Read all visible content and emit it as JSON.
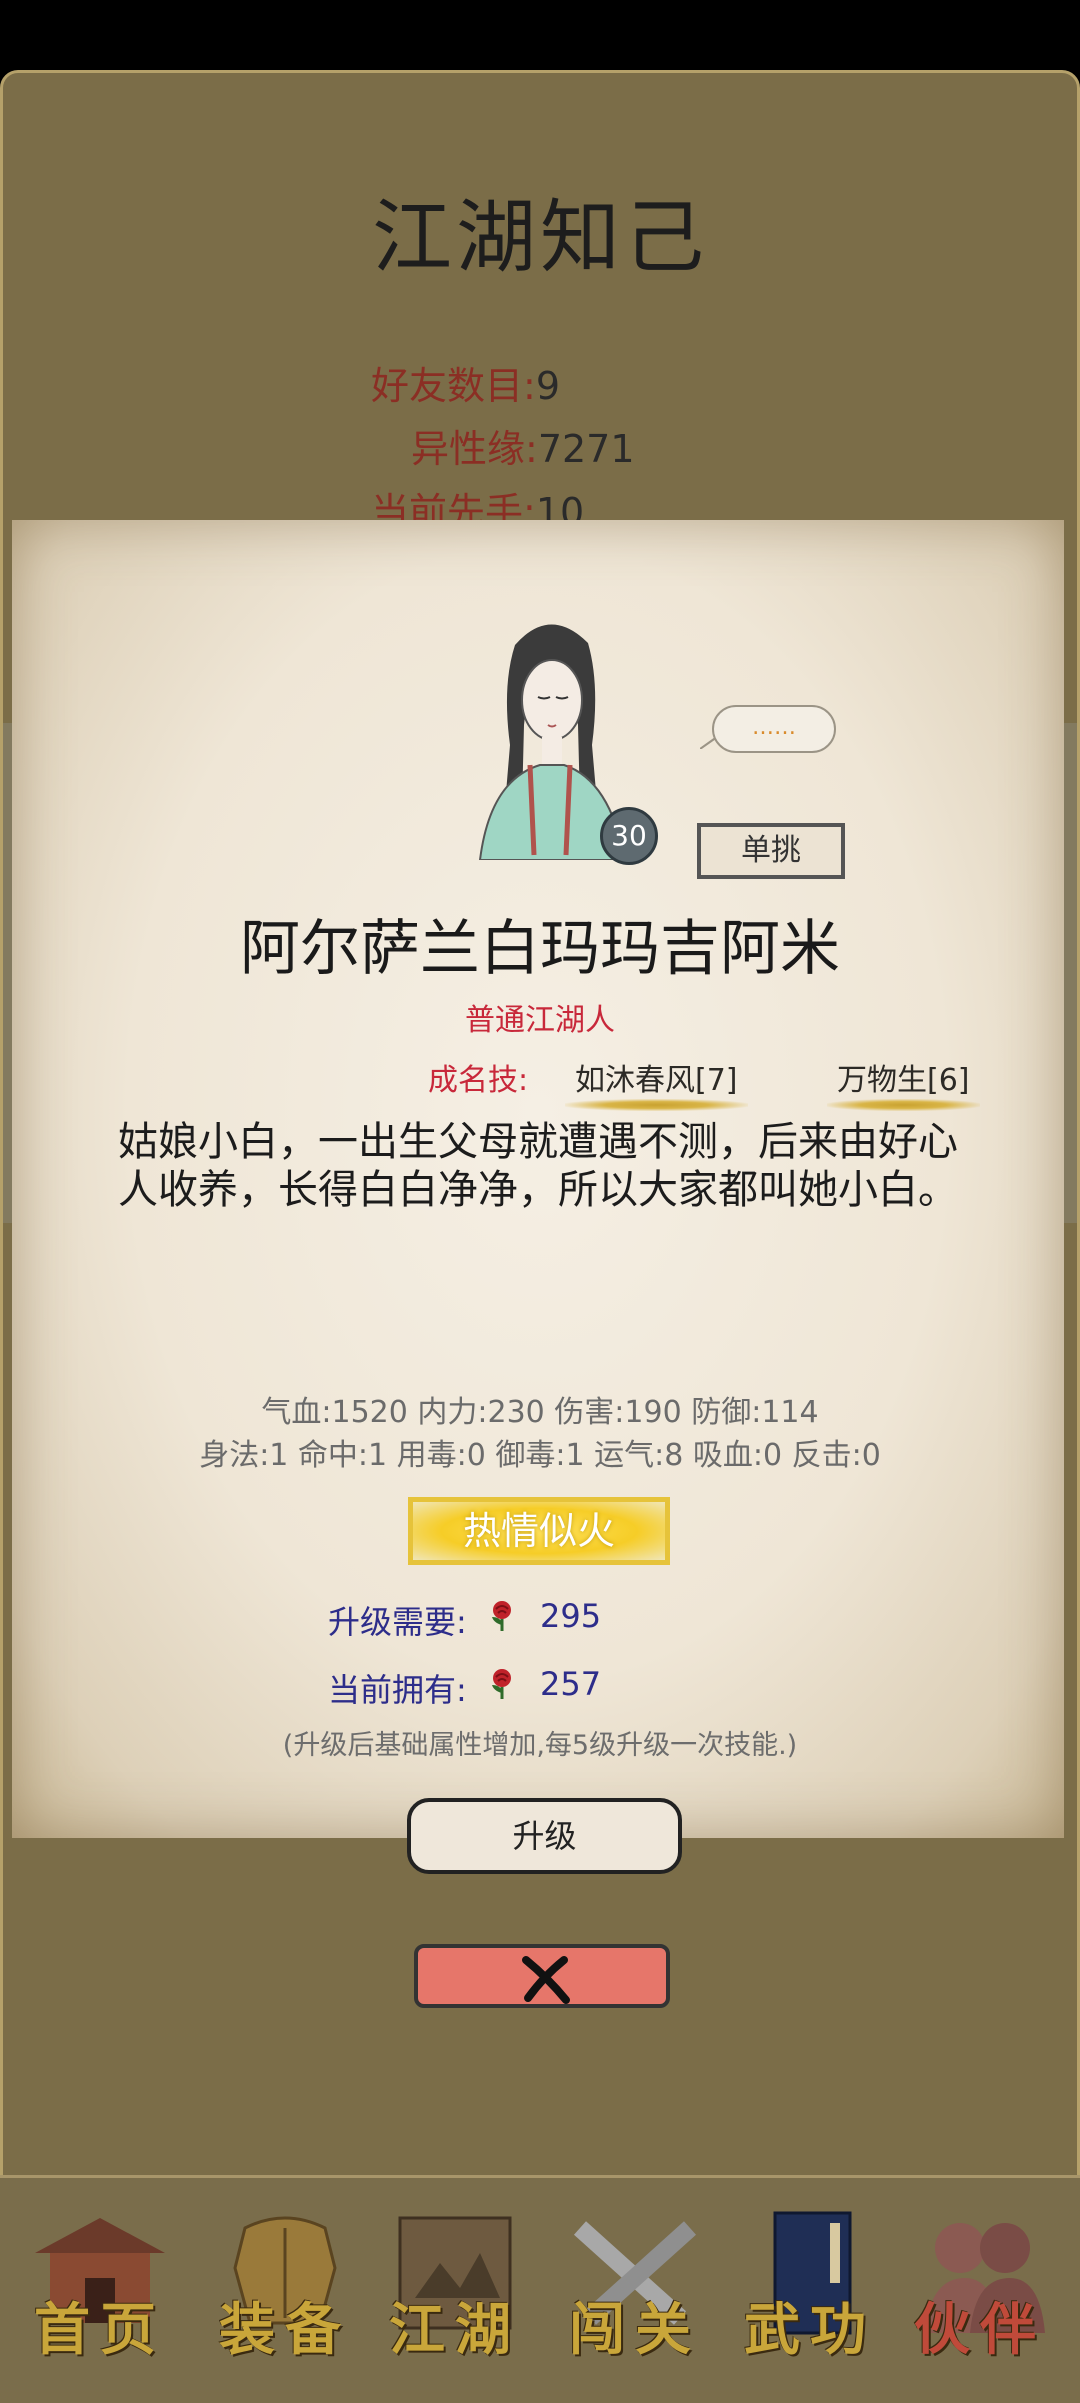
{
  "title": "江湖知己",
  "stats": {
    "friends_label": "好友数目:",
    "friends_value": "9",
    "affinity_label": "异性缘:",
    "affinity_value": "7271",
    "initiative_label": "当前先手:",
    "initiative_value": "10"
  },
  "hero": {
    "level": "30",
    "speech": "……",
    "duel_label": "单挑",
    "name": "阿尔萨兰白玛玛吉阿米",
    "rank": "普通江湖人",
    "skills_label": "成名技:",
    "skills": [
      "如沐春风[7]",
      "万物生[6]"
    ],
    "bio": "姑娘小白，一出生父母就遭遇不测，后来由好心人收养，长得白白净净，所以大家都叫她小白。",
    "attributes_line1": "气血:1520  内力:230  伤害:190  防御:114",
    "attributes_line2": "身法:1  命中:1  用毒:0  御毒:1  运气:8  吸血:0  反击:0",
    "mood_label": "热情似火",
    "upgrade_need_label": "升级需要:",
    "upgrade_need_value": "295",
    "current_have_label": "当前拥有:",
    "current_have_value": "257",
    "note": "(升级后基础属性增加,每5级升级一次技能.)",
    "upgrade_button": "升级"
  },
  "nav": [
    {
      "label": "首页",
      "icon": "house-icon"
    },
    {
      "label": "装备",
      "icon": "armor-icon"
    },
    {
      "label": "江湖",
      "icon": "map-scroll-icon"
    },
    {
      "label": "闯关",
      "icon": "crossed-swords-icon"
    },
    {
      "label": "武功",
      "icon": "book-icon"
    },
    {
      "label": "伙伴",
      "icon": "partners-icon",
      "active": true
    }
  ],
  "colors": {
    "background": "#7b6d48",
    "stat_label": "#8b2e24",
    "rank_red": "#c8283a",
    "currency_blue": "#2d2d8a",
    "mood_yellow": "#f6cd27",
    "close_red": "#e6766a"
  }
}
